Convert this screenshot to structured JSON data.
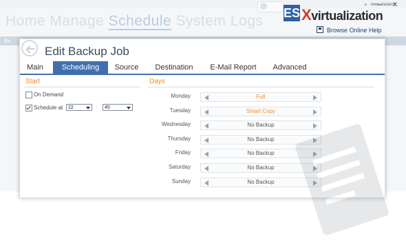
{
  "background": {
    "nav_items": [
      "Home",
      "Manage",
      "Schedule",
      "System Logs"
    ],
    "active_nav": "Schedule",
    "strip_label": "Bx",
    "help_link": "Browse Online Help"
  },
  "watermark": {
    "logo_letters": "ES",
    "logo_text": "virtualization",
    "site": "www.vladan.fr"
  },
  "dialog": {
    "title": "Edit Backup Job",
    "tabs": [
      {
        "label": "Main",
        "active": false
      },
      {
        "label": "Scheduling",
        "active": true
      },
      {
        "label": "Source",
        "active": false
      },
      {
        "label": "Destination",
        "active": false
      },
      {
        "label": "E-Mail Report",
        "active": false
      },
      {
        "label": "Advanced",
        "active": false
      }
    ],
    "start": {
      "header": "Start",
      "on_demand": {
        "label": "On Demand",
        "checked": false
      },
      "schedule_at": {
        "label": "Schedule at",
        "checked": true,
        "hour": "22",
        "minute": "45"
      }
    },
    "days": {
      "header": "Days",
      "rows": [
        {
          "day": "Monday",
          "value": "Full",
          "accent": true
        },
        {
          "day": "Tuesday",
          "value": "Smart Copy",
          "accent": true
        },
        {
          "day": "Wednesday",
          "value": "No Backup",
          "accent": false
        },
        {
          "day": "Thursday",
          "value": "No Backup",
          "accent": false
        },
        {
          "day": "Friday",
          "value": "No Backup",
          "accent": false
        },
        {
          "day": "Saturday",
          "value": "No Backup",
          "accent": false
        },
        {
          "day": "Sunday",
          "value": "No Backup",
          "accent": false
        }
      ]
    }
  },
  "colors": {
    "accent_orange": "#f08a2a",
    "tab_blue": "#3f6fae",
    "text_gray": "#555555"
  }
}
